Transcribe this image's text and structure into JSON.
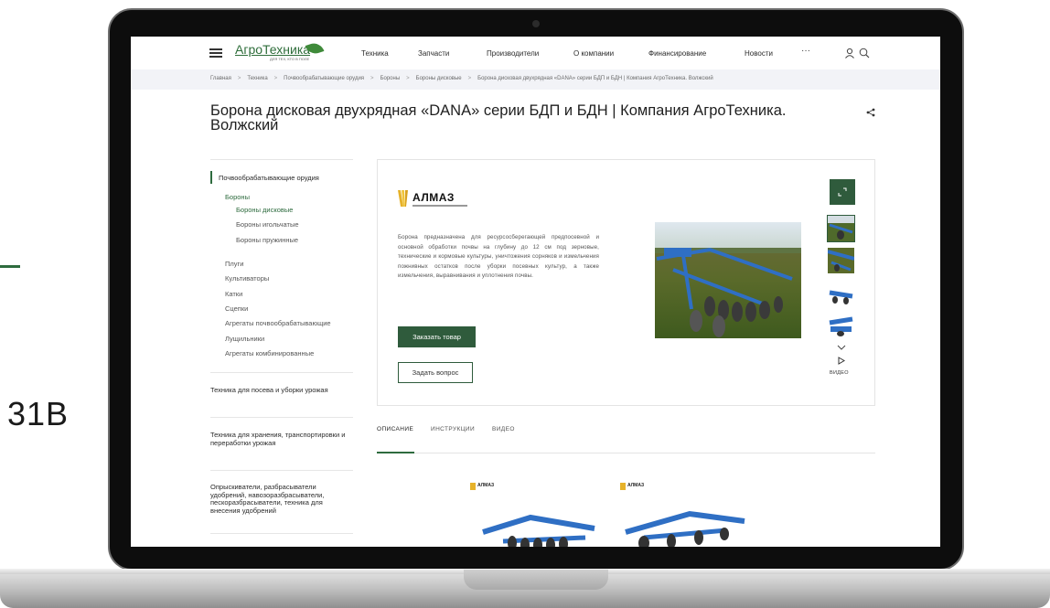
{
  "outside": {
    "text": "31B"
  },
  "site": {
    "logo_name": "АгроТехника",
    "logo_sub": "ДЛЯ ТЕХ, КТО В ПОЛЕ",
    "nav": [
      {
        "label": "Техника"
      },
      {
        "label": "Запчасти"
      },
      {
        "label": "Производители"
      },
      {
        "label": "О компании"
      },
      {
        "label": "Финансирование"
      },
      {
        "label": "Новости"
      }
    ],
    "nav_more": "···",
    "icons": {
      "menu": "hamburger-icon",
      "user": "user-icon",
      "search": "search-icon",
      "share": "share-icon"
    },
    "accent": "#2f5b3c",
    "breadcrumbs": [
      {
        "label": "Главная"
      },
      {
        "label": "Техника"
      },
      {
        "label": "Почвообрабатывающие орудия"
      },
      {
        "label": "Бороны"
      },
      {
        "label": "Бороны дисковые"
      },
      {
        "label": "Борона дисковая двухрядная «DANA» серии БДП и БДН | Компания АгроТехника. Волжский"
      }
    ],
    "crumb_sep": ">",
    "title": "Борона дисковая двухрядная «DANA» серии БДП и БДН | Компания АгроТехника. Волжский"
  },
  "sidebar": {
    "active_section": "Почвообрабатывающие орудия",
    "sub_section": "Бороны",
    "harrows": [
      {
        "label": "Бороны дисковые"
      },
      {
        "label": "Бороны игольчатые"
      },
      {
        "label": "Бороны пружинные"
      }
    ],
    "items": [
      {
        "label": "Плуги"
      },
      {
        "label": "Культиваторы"
      },
      {
        "label": "Катки"
      },
      {
        "label": "Сцепки"
      },
      {
        "label": "Агрегаты почвообрабатывающие"
      },
      {
        "label": "Лущильники"
      },
      {
        "label": "Агрегаты комбинированные"
      }
    ],
    "blocks": [
      {
        "label": "Техника для посева и уборки урожая"
      },
      {
        "label": "Техника для хранения, транспортировки и переработки урожая"
      },
      {
        "label": "Опрыскиватели, разбрасыватели удобрений, навозоразбрасыватели, пескоразбрасыватели, техника для внесения удобрений"
      }
    ]
  },
  "product": {
    "brand": "АЛМАЗ",
    "description": "Борона предназначена для ресурсосберегающей предпосевной и основной обработки почвы на глубину до 12 см под зерновые, технические и кормовые культуры, уничтожения сорняков и измельчения пожнивных остатков после уборки посевных культур, а также измельчения, выравнивания и уплотнения почвы.",
    "order_label": "Заказать товар",
    "ask_label": "Задать вопрос",
    "video_label": "ВИДЕО",
    "machine_color": "#2f6fc4"
  },
  "tabs": [
    {
      "label": "ОПИСАНИЕ"
    },
    {
      "label": "ИНСТРУКЦИИ"
    },
    {
      "label": "ВИДЕО"
    }
  ],
  "tiles": [
    {
      "brand": "АЛМАЗ"
    },
    {
      "brand": "АЛМАЗ"
    }
  ]
}
